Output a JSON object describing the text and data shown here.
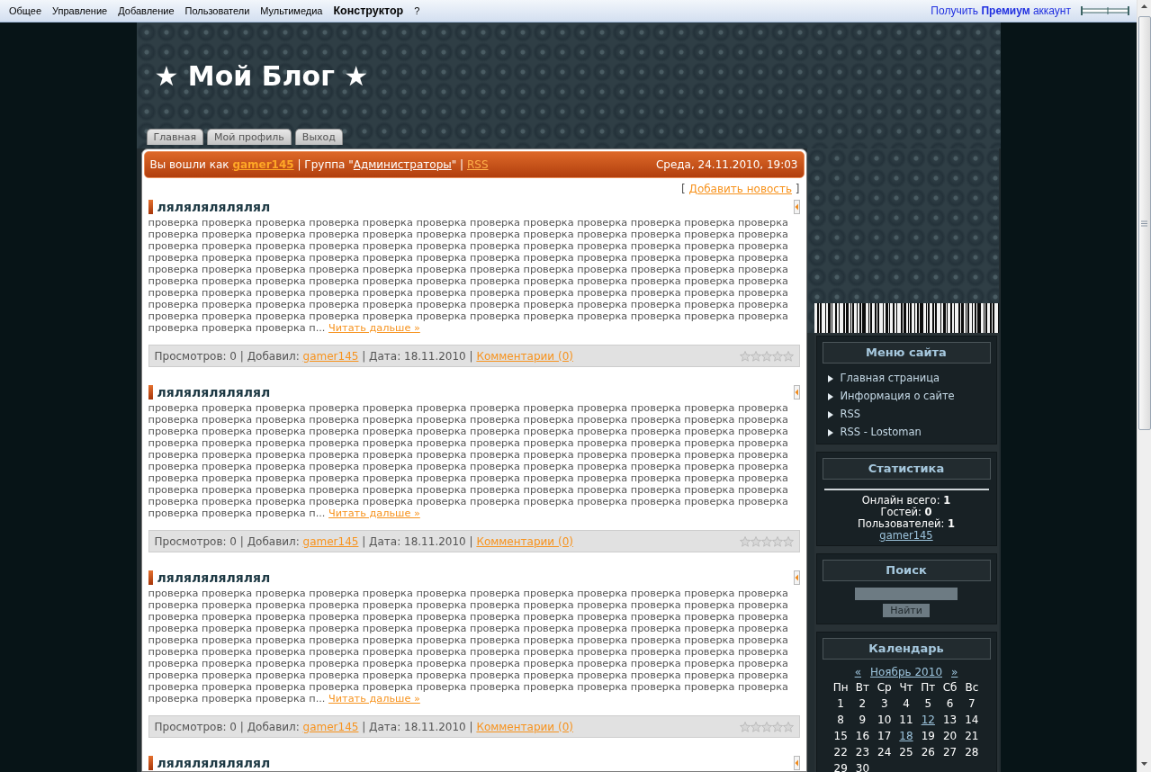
{
  "top_menu": [
    {
      "label": "Общее",
      "selected": false
    },
    {
      "label": "Управление",
      "selected": false
    },
    {
      "label": "Добавление",
      "selected": false
    },
    {
      "label": "Пользователи",
      "selected": false
    },
    {
      "label": "Мультимедиа",
      "selected": false
    },
    {
      "label": "Конструктор",
      "selected": true
    },
    {
      "label": "?",
      "selected": false
    }
  ],
  "premium_link": "Получить **Премиум** аккаунт",
  "header": {
    "title": "★ Мой Блог ★",
    "tabs": [
      "Главная",
      "Мой профиль",
      "Выход"
    ]
  },
  "login_bar": {
    "segments": [
      {
        "kind": "text",
        "text": "Вы вошли как "
      },
      {
        "kind": "bold_link",
        "text": "gamer145"
      },
      {
        "kind": "text",
        "text": " | Группа \""
      },
      {
        "kind": "light_link",
        "text": "Администраторы"
      },
      {
        "kind": "text",
        "text": "\" | "
      },
      {
        "kind": "link",
        "text": "RSS"
      }
    ],
    "datetime": "Среда, 24.11.2010, 19:03"
  },
  "add_news": {
    "open": "[",
    "link": "Добавить новость",
    "close": "]"
  },
  "posts": [
    {
      "title": "лялялялялялял",
      "excerpt_lines": [
        "проверка проверка проверка проверка проверка проверка проверка проверка проверка проверка проверка проверка",
        "проверка проверка проверка проверка проверка проверка проверка проверка проверка проверка проверка проверка",
        "проверка проверка проверка проверка проверка проверка проверка проверка проверка проверка проверка проверка",
        "проверка проверка проверка проверка проверка проверка проверка проверка проверка проверка проверка проверка",
        "проверка проверка проверка проверка проверка проверка проверка проверка проверка проверка проверка проверка",
        "проверка проверка проверка проверка проверка проверка проверка проверка проверка проверка проверка проверка",
        "проверка проверка проверка проверка проверка проверка проверка проверка проверка проверка проверка проверка",
        "проверка проверка проверка проверка проверка проверка проверка проверка проверка проверка проверка проверка",
        "проверка проверка проверка проверка проверка проверка проверка проверка проверка проверка проверка проверка",
        "проверка проверка проверка п..."
      ],
      "read_more": "Читать дальше »",
      "meta": [
        {
          "kind": "text",
          "text": "Просмотров: 0 | Добавил: "
        },
        {
          "kind": "link",
          "text": "gamer145"
        },
        {
          "kind": "text",
          "text": " | Дата: 18.11.2010 | "
        },
        {
          "kind": "link",
          "text": "Комментарии (0)"
        }
      ],
      "stars": 0
    },
    {
      "title": "лялялялялялял",
      "excerpt_lines": [
        "проверка проверка проверка проверка проверка проверка проверка проверка проверка проверка проверка проверка",
        "проверка проверка проверка проверка проверка проверка проверка проверка проверка проверка проверка проверка",
        "проверка проверка проверка проверка проверка проверка проверка проверка проверка проверка проверка проверка",
        "проверка проверка проверка проверка проверка проверка проверка проверка проверка проверка проверка проверка",
        "проверка проверка проверка проверка проверка проверка проверка проверка проверка проверка проверка проверка",
        "проверка проверка проверка проверка проверка проверка проверка проверка проверка проверка проверка проверка",
        "проверка проверка проверка проверка проверка проверка проверка проверка проверка проверка проверка проверка",
        "проверка проверка проверка проверка проверка проверка проверка проверка проверка проверка проверка проверка",
        "проверка проверка проверка проверка проверка проверка проверка проверка проверка проверка проверка проверка",
        "проверка проверка проверка п..."
      ],
      "read_more": "Читать дальше »",
      "meta": [
        {
          "kind": "text",
          "text": "Просмотров: 0 | Добавил: "
        },
        {
          "kind": "link",
          "text": "gamer145"
        },
        {
          "kind": "text",
          "text": " | Дата: 18.11.2010 | "
        },
        {
          "kind": "link",
          "text": "Комментарии (0)"
        }
      ],
      "stars": 0
    },
    {
      "title": "лялялялялялял",
      "excerpt_lines": [
        "проверка проверка проверка проверка проверка проверка проверка проверка проверка проверка проверка проверка",
        "проверка проверка проверка проверка проверка проверка проверка проверка проверка проверка проверка проверка",
        "проверка проверка проверка проверка проверка проверка проверка проверка проверка проверка проверка проверка",
        "проверка проверка проверка проверка проверка проверка проверка проверка проверка проверка проверка проверка",
        "проверка проверка проверка проверка проверка проверка проверка проверка проверка проверка проверка проверка",
        "проверка проверка проверка проверка проверка проверка проверка проверка проверка проверка проверка проверка",
        "проверка проверка проверка проверка проверка проверка проверка проверка проверка проверка проверка проверка",
        "проверка проверка проверка проверка проверка проверка проверка проверка проверка проверка проверка проверка",
        "проверка проверка проверка проверка проверка проверка проверка проверка проверка проверка проверка проверка",
        "проверка проверка проверка п..."
      ],
      "read_more": "Читать дальше »",
      "meta": [
        {
          "kind": "text",
          "text": "Просмотров: 0 | Добавил: "
        },
        {
          "kind": "link",
          "text": "gamer145"
        },
        {
          "kind": "text",
          "text": " | Дата: 18.11.2010 | "
        },
        {
          "kind": "link",
          "text": "Комментарии (0)"
        }
      ],
      "stars": 0
    },
    {
      "title": "лялялялялялял"
    }
  ],
  "sidebar": {
    "blocks": [
      {
        "kind": "menu",
        "title": "Меню сайта",
        "items": [
          "Главная страница",
          "Информация о сайте",
          "RSS",
          "RSS - Lostoman"
        ]
      },
      {
        "kind": "stats",
        "title": "Статистика",
        "lines": [
          "Онлайн всего: **1**",
          "Гостей: **0**",
          "Пользователей: **1**"
        ],
        "user": "gamer145"
      },
      {
        "kind": "search",
        "title": "Поиск",
        "button": "Найти"
      },
      {
        "kind": "calendar",
        "title": "Календарь",
        "prev": "«",
        "month": "Ноябрь 2010",
        "next": "»",
        "weekdays": [
          "Пн",
          "Вт",
          "Ср",
          "Чт",
          "Пт",
          "Сб",
          "Вс"
        ],
        "weeks": [
          [
            {
              "day": "1",
              "linked": false
            },
            {
              "day": "2",
              "linked": false
            },
            {
              "day": "3",
              "linked": false
            },
            {
              "day": "4",
              "linked": false
            },
            {
              "day": "5",
              "linked": false
            },
            {
              "day": "6",
              "linked": false
            },
            {
              "day": "7",
              "linked": false
            }
          ],
          [
            {
              "day": "8",
              "linked": false
            },
            {
              "day": "9",
              "linked": false
            },
            {
              "day": "10",
              "linked": false
            },
            {
              "day": "11",
              "linked": false
            },
            {
              "day": "12",
              "linked": true
            },
            {
              "day": "13",
              "linked": false
            },
            {
              "day": "14",
              "linked": false
            }
          ],
          [
            {
              "day": "15",
              "linked": false
            },
            {
              "day": "16",
              "linked": false
            },
            {
              "day": "17",
              "linked": false
            },
            {
              "day": "18",
              "linked": true
            },
            {
              "day": "19",
              "linked": false
            },
            {
              "day": "20",
              "linked": false
            },
            {
              "day": "21",
              "linked": false
            }
          ],
          [
            {
              "day": "22",
              "linked": false
            },
            {
              "day": "23",
              "linked": false
            },
            {
              "day": "24",
              "linked": false
            },
            {
              "day": "25",
              "linked": false
            },
            {
              "day": "26",
              "linked": false
            },
            {
              "day": "27",
              "linked": false
            },
            {
              "day": "28",
              "linked": false
            }
          ],
          [
            {
              "day": "29",
              "linked": false
            },
            {
              "day": "30",
              "linked": false
            }
          ]
        ]
      }
    ]
  }
}
